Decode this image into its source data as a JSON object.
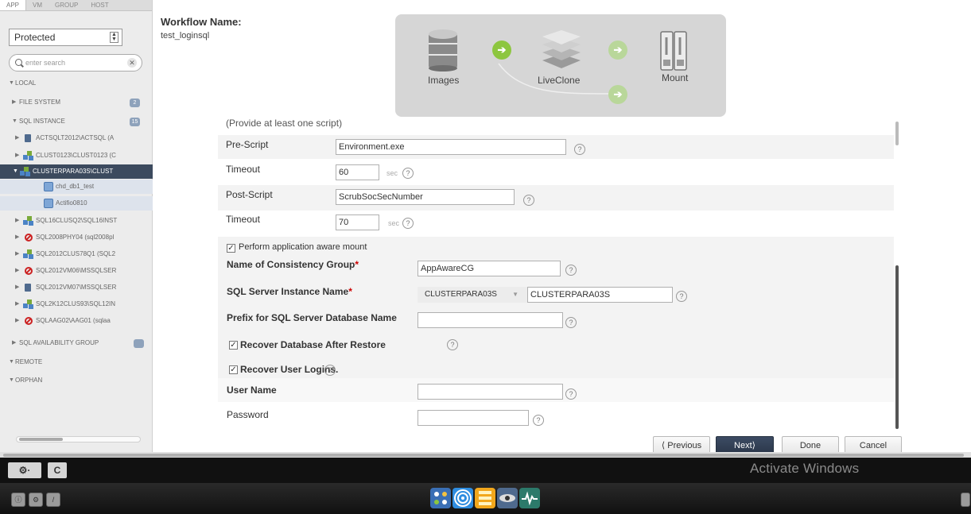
{
  "sidebar": {
    "tabs": [
      "APP",
      "VM",
      "GROUP",
      "HOST"
    ],
    "filter_value": "Protected",
    "search_placeholder": "enter search",
    "tree": [
      {
        "label": "LOCAL"
      },
      {
        "label": "FILE SYSTEM",
        "badge": "2"
      },
      {
        "label": "SQL INSTANCE",
        "badge": "15"
      },
      {
        "label": "ACTSQLT2012\\ACTSQL (A"
      },
      {
        "label": "CLUST0123\\CLUST0123 (C"
      },
      {
        "label": "CLUSTERPARA03S\\CLUST"
      },
      {
        "label": "chd_db1_test"
      },
      {
        "label": "Actifio0810"
      },
      {
        "label": "SQL16CLUSQ2\\SQL16INST"
      },
      {
        "label": "SQL2008PHY04 (sql2008pl"
      },
      {
        "label": "SQL2012CLUS78Q1 (SQL2"
      },
      {
        "label": "SQL2012VM06\\MSSQLSER"
      },
      {
        "label": "SQL2012VM07\\MSSQLSER"
      },
      {
        "label": "SQL2K12CLUS93\\SQL12IN"
      },
      {
        "label": "SQLAAG02\\AAG01 (sqlaa"
      },
      {
        "label": "SQL AVAILABILITY GROUP"
      },
      {
        "label": "REMOTE"
      },
      {
        "label": "ORPHAN"
      }
    ]
  },
  "workflow": {
    "title": "Workflow Name:",
    "name": "test_loginsql",
    "steps": {
      "images": "Images",
      "liveclone": "LiveClone",
      "mount": "Mount"
    }
  },
  "form": {
    "hint": "(Provide at least one script)",
    "pre_script_label": "Pre-Script",
    "pre_script_value": "Environment.exe",
    "timeout1_label": "Timeout",
    "timeout1_value": "60",
    "post_script_label": "Post-Script",
    "post_script_value": "ScrubSocSecNumber",
    "timeout2_label": "Timeout",
    "timeout2_value": "70",
    "unit": "sec",
    "app_aware_label": "Perform application aware mount",
    "consistency_label": "Name of Consistency Group",
    "consistency_value": "AppAwareCG",
    "instance_label": "SQL Server Instance Name",
    "instance_select": "CLUSTERPARA03S",
    "instance_value": "CLUSTERPARA03S",
    "prefix_label": "Prefix for SQL Server Database Name",
    "prefix_value": "",
    "recover_db_label": "Recover Database After Restore",
    "recover_logins_label": "Recover User Logins.",
    "username_label": "User Name",
    "username_value": "",
    "password_label": "Password",
    "password_value": "",
    "required_mark": "*",
    "help_glyph": "?",
    "check_glyph": "✓"
  },
  "buttons": {
    "previous": "⟨ Previous",
    "next": "Next⟩",
    "done": "Done",
    "cancel": "Cancel"
  },
  "toolbar": {
    "settings": "⚙·",
    "refresh": "C"
  },
  "watermark": "Activate Windows",
  "colors": {
    "sidebar_selected": "#3c4a5e",
    "accent_green": "#8dc63f",
    "primary_button": "#2a3649"
  }
}
